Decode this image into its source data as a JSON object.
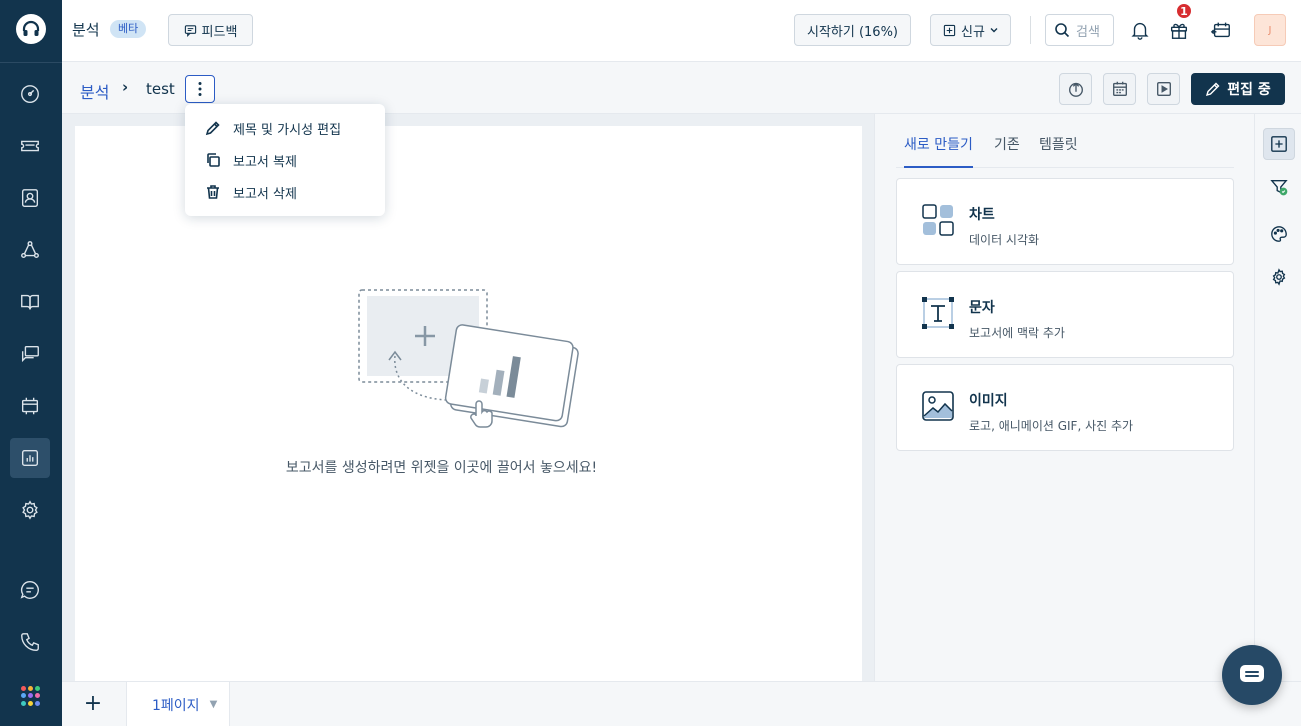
{
  "topbar": {
    "app_title": "분석",
    "beta_label": "베타",
    "feedback_label": "피드백",
    "get_started_label": "시작하기 (16%)",
    "new_label": "신규",
    "search_placeholder": "검색",
    "gift_badge_count": "1",
    "avatar_initial": "J"
  },
  "breadcrumb": {
    "parent": "분석",
    "current": "test"
  },
  "subheader": {
    "editing_label": "편집 중"
  },
  "dropdown": {
    "items": [
      {
        "label": "제목 및 가시성 편집",
        "icon": "pencil-icon"
      },
      {
        "label": "보고서 복제",
        "icon": "copy-icon"
      },
      {
        "label": "보고서 삭제",
        "icon": "trash-icon"
      }
    ]
  },
  "canvas": {
    "empty_message": "보고서를 생성하려면 위젯을 이곳에 끌어서 놓으세요!"
  },
  "panel": {
    "tabs": [
      {
        "label": "새로 만들기",
        "active": true
      },
      {
        "label": "기존",
        "active": false
      },
      {
        "label": "템플릿",
        "active": false
      }
    ],
    "widgets": [
      {
        "title": "차트",
        "description": "데이터 시각화",
        "icon": "chart-widget-icon"
      },
      {
        "title": "문자",
        "description": "보고서에 맥락 추가",
        "icon": "text-widget-icon"
      },
      {
        "title": "이미지",
        "description": "로고, 애니메이션 GIF, 사진 추가",
        "icon": "image-widget-icon"
      }
    ]
  },
  "bottombar": {
    "add_page": "+",
    "page_tab_label": "1페이지"
  },
  "colors": {
    "nav_bg": "#12344d",
    "accent": "#2c5cc5",
    "badge_red": "#d72d30"
  }
}
